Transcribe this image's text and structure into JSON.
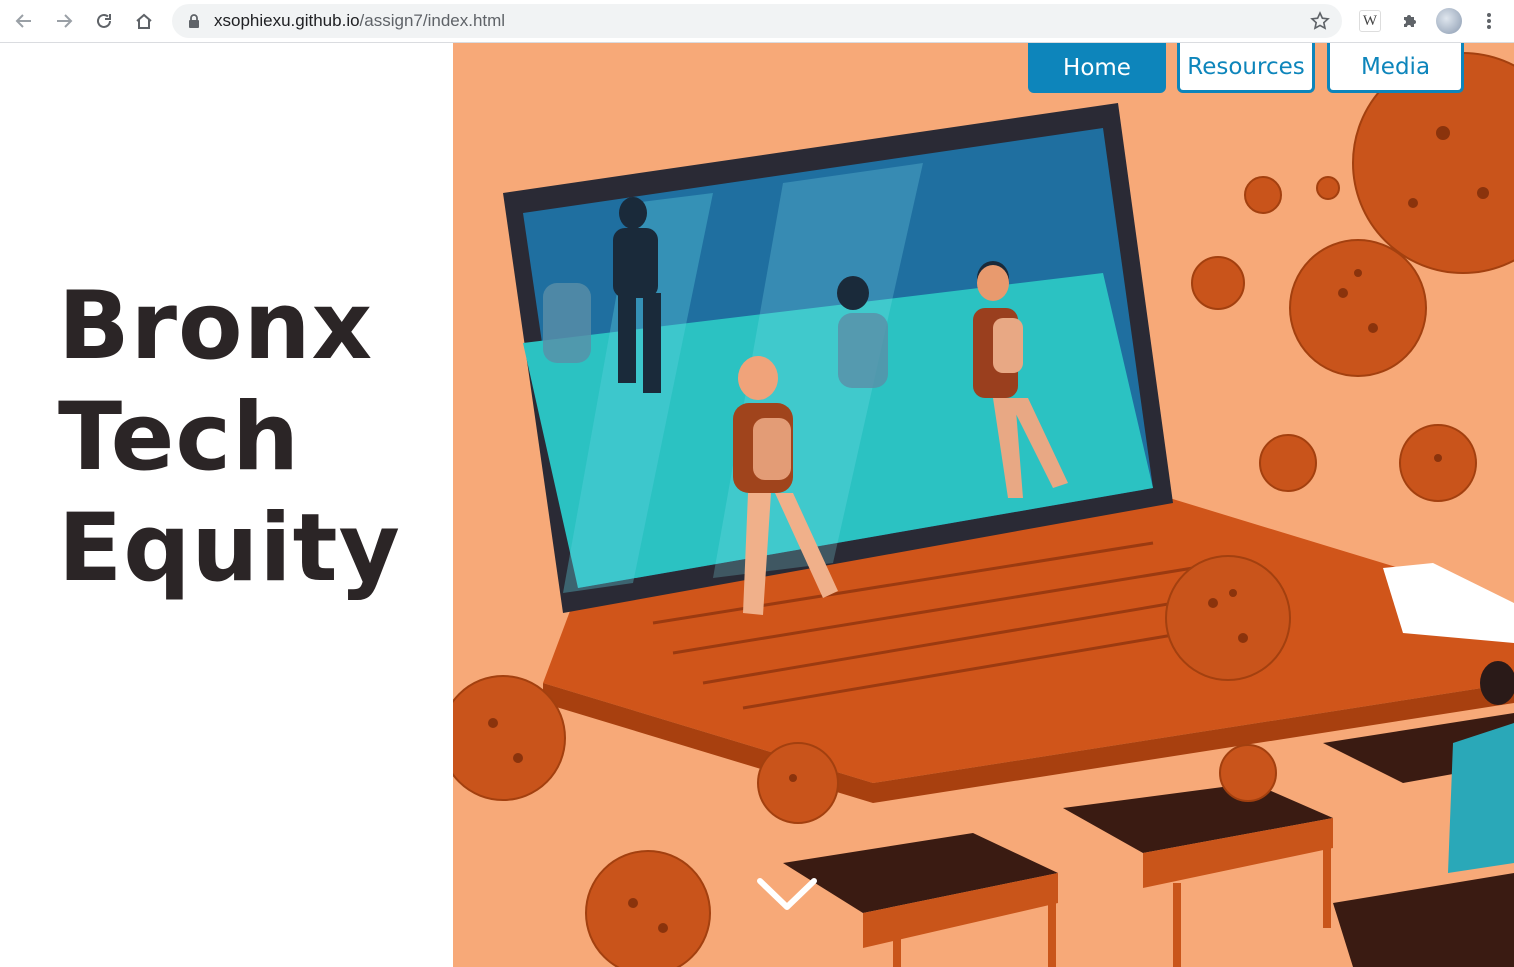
{
  "browser": {
    "url_host": "xsophiexu.github.io",
    "url_path": "/assign7/index.html",
    "icons": [
      "back-icon",
      "forward-icon",
      "reload-icon",
      "home-icon",
      "lock-icon",
      "bookmark-star-icon",
      "w-extension-icon",
      "extensions-puzzle-icon",
      "profile-avatar",
      "menu-icon"
    ],
    "extension_letter": "W"
  },
  "hero": {
    "title_lines": [
      "Bronx",
      "Tech",
      "Equity"
    ],
    "nav": [
      {
        "label": "Home",
        "active": true
      },
      {
        "label": "Resources",
        "active": false
      },
      {
        "label": "Media",
        "active": false
      }
    ],
    "scroll_icon": "chevron-down-icon",
    "illustration": "laptop-classroom-virus-illustration"
  },
  "colors": {
    "accent": "#0d85bb",
    "title": "#2b2526",
    "illustration_bg": "#f7a978",
    "virus": "#c9541b"
  }
}
